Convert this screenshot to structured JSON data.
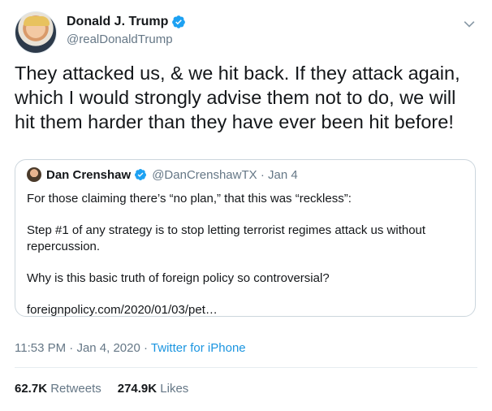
{
  "tweet": {
    "author": {
      "display_name": "Donald J. Trump",
      "handle": "@realDonaldTrump"
    },
    "text": "They attacked us, & we hit back. If they attack again, which I would strongly advise them not to do, we will hit them harder than they have ever been hit before!",
    "time": "11:53 PM",
    "date": "Jan 4, 2020",
    "source": "Twitter for iPhone",
    "separator": "·",
    "retweets": {
      "count": "62.7K",
      "label": "Retweets"
    },
    "likes": {
      "count": "274.9K",
      "label": "Likes"
    }
  },
  "quoted": {
    "author": {
      "display_name": "Dan Crenshaw",
      "handle": "@DanCrenshawTX",
      "date": "Jan 4"
    },
    "paragraphs": [
      "For those claiming there’s “no plan,” that this was “reckless”:",
      "Step #1 of any strategy is to stop letting terrorist regimes attack us without repercussion.",
      "Why is this basic truth of foreign policy so controversial?",
      "foreignpolicy.com/2020/01/03/pet…"
    ]
  },
  "icons": [
    "avatar",
    "verified-badge-icon",
    "chevron-down-icon"
  ],
  "colors": {
    "text": "#14171a",
    "secondary": "#657786",
    "link": "#1b95e0",
    "verified": "#1da1f2",
    "border": "#ccd6dd"
  }
}
